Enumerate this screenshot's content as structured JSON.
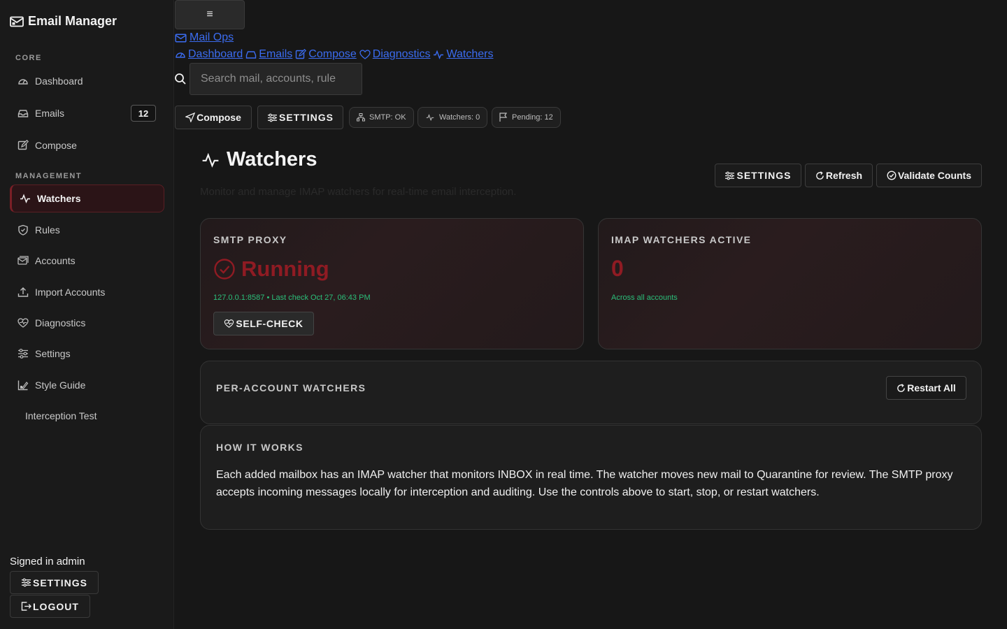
{
  "sidebar": {
    "brand": "Email Manager",
    "sections": {
      "core": "CORE",
      "management": "MANAGEMENT"
    },
    "items": [
      {
        "label": "Dashboard"
      },
      {
        "label": "Emails",
        "badge": "12"
      },
      {
        "label": "Compose"
      },
      {
        "label": "Watchers"
      },
      {
        "label": "Rules"
      },
      {
        "label": "Accounts"
      },
      {
        "label": "Import Accounts"
      },
      {
        "label": "Diagnostics"
      },
      {
        "label": "Settings"
      },
      {
        "label": "Style Guide"
      },
      {
        "label": "Interception Test"
      }
    ],
    "signed_in": "Signed in admin",
    "settings_btn": "SETTINGS",
    "logout_btn": "LOGOUT"
  },
  "header": {
    "menu_glyph": "≡",
    "mail_ops": "Mail Ops",
    "breadcrumbs": [
      "Dashboard",
      "Emails",
      "Compose",
      "Diagnostics",
      "Watchers"
    ],
    "search_placeholder": "Search mail, accounts, rule"
  },
  "toolbar": {
    "compose": "Compose",
    "settings": "SETTINGS",
    "pills": [
      "SMTP: OK",
      "Watchers: 0",
      "Pending: 12"
    ]
  },
  "page": {
    "title": "Watchers",
    "subtitle": "Monitor and manage IMAP watchers for real-time email interception.",
    "buttons": {
      "settings": "SETTINGS",
      "refresh": "Refresh",
      "validate": "Validate Counts"
    }
  },
  "smtp_card": {
    "label": "SMTP PROXY",
    "status": "Running",
    "meta": "127.0.0.1:8587 • Last check Oct 27, 06:43 PM",
    "button": "SELF-CHECK"
  },
  "imap_card": {
    "label": "IMAP WATCHERS ACTIVE",
    "count": "0",
    "meta": "Across all accounts"
  },
  "per_account": {
    "label": "PER-ACCOUNT WATCHERS",
    "button": "Restart All"
  },
  "how_it_works": {
    "label": "HOW IT WORKS",
    "text": "Each added mailbox has an IMAP watcher that monitors INBOX in real time. The watcher moves new mail to Quarantine for review. The SMTP proxy accepts incoming messages locally for interception and auditing. Use the controls above to start, stop, or restart watchers."
  },
  "colors": {
    "accent_red": "#8f1b23",
    "link_blue": "#3b6cf0",
    "ok_green": "#2bbf7a",
    "background": "#171717"
  }
}
